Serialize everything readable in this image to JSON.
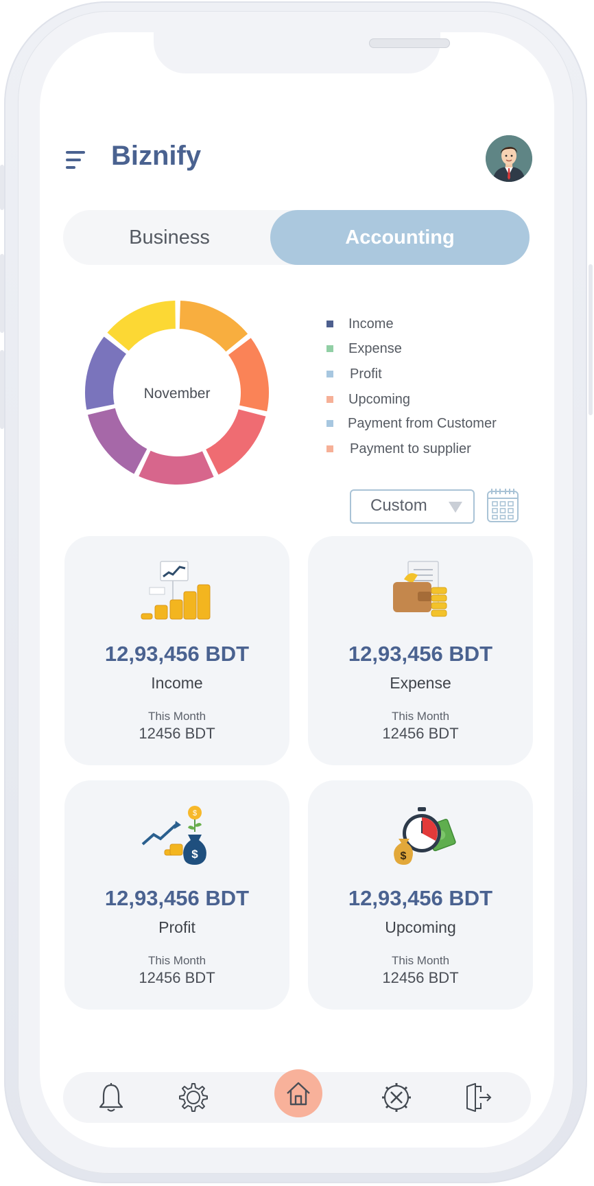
{
  "app": {
    "title": "Biznify"
  },
  "tabs": [
    {
      "label": "Business",
      "active": false
    },
    {
      "label": "Accounting",
      "active": true
    }
  ],
  "chart_data": {
    "type": "pie",
    "variant": "donut",
    "center_label": "November",
    "slices_visible": [
      {
        "color": "#f8ae3f"
      },
      {
        "color": "#fa8357"
      },
      {
        "color": "#ef6c72"
      },
      {
        "color": "#d7668c"
      },
      {
        "color": "#a668a8"
      },
      {
        "color": "#7a74bc"
      },
      {
        "color": "#fcd834"
      }
    ],
    "legend": [
      {
        "name": "Income",
        "color": "#4d5f8e"
      },
      {
        "name": "Expense",
        "color": "#91cfa5"
      },
      {
        "name": "Profit",
        "color": "#a7c7e0"
      },
      {
        "name": "Upcoming",
        "color": "#f6b097"
      },
      {
        "name": "Payment from Customer",
        "color": "#a7c7e0"
      },
      {
        "name": "Payment to supplier",
        "color": "#f6b097"
      }
    ]
  },
  "filter": {
    "selected": "Custom"
  },
  "cards": [
    {
      "amount": "12,93,456 BDT",
      "title": "Income",
      "sub_label": "This Month",
      "sub_value": "12456 BDT",
      "icon": "coins-growth-icon"
    },
    {
      "amount": "12,93,456 BDT",
      "title": "Expense",
      "sub_label": "This Month",
      "sub_value": "12456 BDT",
      "icon": "wallet-bills-icon"
    },
    {
      "amount": "12,93,456 BDT",
      "title": "Profit",
      "sub_label": "This Month",
      "sub_value": "12456 BDT",
      "icon": "money-bag-growth-icon"
    },
    {
      "amount": "12,93,456 BDT",
      "title": "Upcoming",
      "sub_label": "This Month",
      "sub_value": "12456 BDT",
      "icon": "stopwatch-money-icon"
    }
  ],
  "nav": {
    "items": [
      "bell-icon",
      "settings-icon",
      "home-icon",
      "tools-icon",
      "logout-icon"
    ],
    "active": "home-icon"
  },
  "colors": {
    "brand": "#4a6290",
    "tab_active": "#abc8de",
    "home_active": "#f8b19a",
    "card_bg": "#f3f5f8"
  }
}
